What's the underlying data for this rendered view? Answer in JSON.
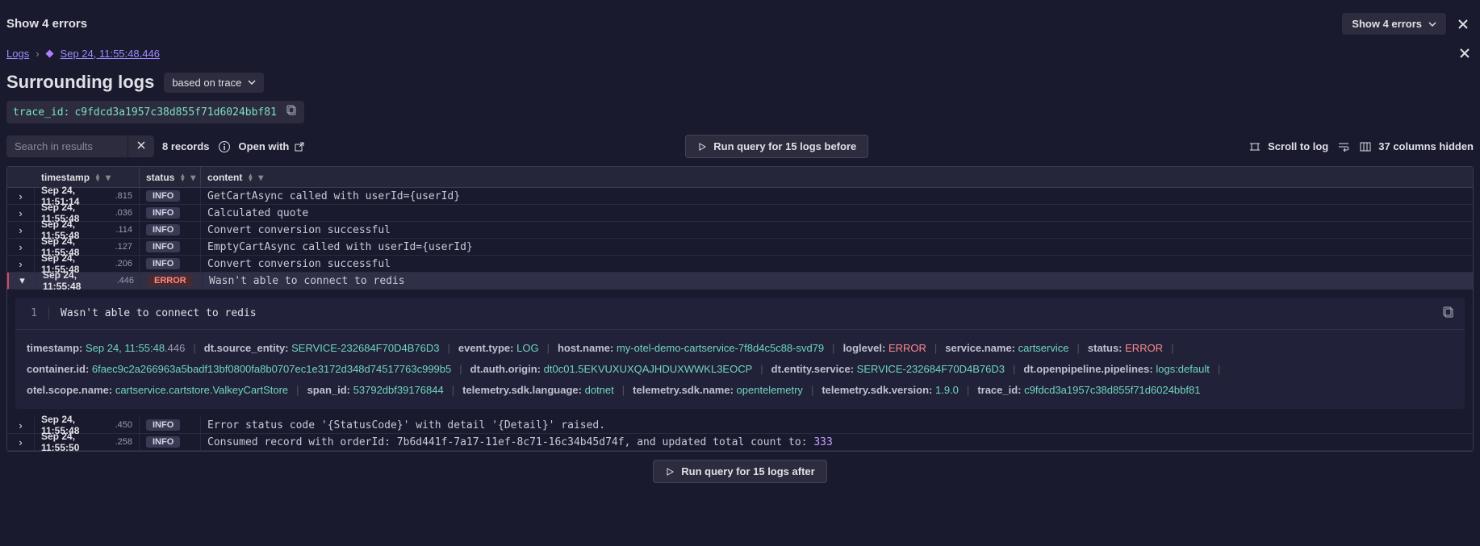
{
  "header": {
    "title": "Show 4 errors",
    "show_errors_btn": "Show 4 errors"
  },
  "breadcrumb": {
    "root": "Logs",
    "current": "Sep 24, 11:55:48",
    "current_ms": ".446"
  },
  "surrounding": {
    "title": "Surrounding logs",
    "mode": "based on trace"
  },
  "trace": {
    "key": "trace_id:",
    "value": "c9fdcd3a1957c38d855f71d6024bbf81"
  },
  "toolbar": {
    "search_placeholder": "Search in results",
    "records": "8 records",
    "open_with": "Open with",
    "run_before": "Run query for 15 logs before",
    "scroll": "Scroll to log",
    "columns_hidden": "37 columns hidden"
  },
  "columns": {
    "timestamp": "timestamp",
    "status": "status",
    "content": "content"
  },
  "rows": [
    {
      "ts": "Sep 24, 11:51:14",
      "ms": ".815",
      "status": "INFO",
      "content": "GetCartAsync called with userId={userId}"
    },
    {
      "ts": "Sep 24, 11:55:48",
      "ms": ".036",
      "status": "INFO",
      "content": "Calculated quote"
    },
    {
      "ts": "Sep 24, 11:55:48",
      "ms": ".114",
      "status": "INFO",
      "content": "Convert conversion successful"
    },
    {
      "ts": "Sep 24, 11:55:48",
      "ms": ".127",
      "status": "INFO",
      "content": "EmptyCartAsync called with userId={userId}"
    },
    {
      "ts": "Sep 24, 11:55:48",
      "ms": ".206",
      "status": "INFO",
      "content": "Convert conversion successful"
    },
    {
      "ts": "Sep 24, 11:55:48",
      "ms": ".446",
      "status": "ERROR",
      "content": "Wasn't able to connect to redis",
      "expanded": true
    },
    {
      "ts": "Sep 24, 11:55:48",
      "ms": ".450",
      "status": "INFO",
      "content": "Error status code '{StatusCode}' with detail '{Detail}' raised."
    },
    {
      "ts": "Sep 24, 11:55:50",
      "ms": ".258",
      "status": "INFO",
      "content_pre": "Consumed record with orderId: 7b6d441f-7a17-11ef-8c71-16c34b45d74f, and updated total count to: ",
      "content_num": "333"
    }
  ],
  "detail": {
    "line": "1",
    "text": "Wasn't able to connect to redis",
    "kv": [
      {
        "k": "timestamp:",
        "v": "Sep 24, 11:55:48",
        "ms": ".446"
      },
      {
        "k": "dt.source_entity:",
        "v": "SERVICE-232684F70D4B76D3"
      },
      {
        "k": "event.type:",
        "v": "LOG"
      },
      {
        "k": "host.name:",
        "v": "my-otel-demo-cartservice-7f8d4c5c88-svd79"
      },
      {
        "k": "loglevel:",
        "v": "ERROR",
        "err": true
      },
      {
        "k": "service.name:",
        "v": "cartservice"
      },
      {
        "k": "status:",
        "v": "ERROR",
        "err": true
      },
      {
        "k": "container.id:",
        "v": "6faec9c2a266963a5badf13bf0800fa8b0707ec1e3172d348d74517763c999b5"
      },
      {
        "k": "dt.auth.origin:",
        "v": "dt0c01.5EKVUXUXQAJHDUXWWKL3EOCP"
      },
      {
        "k": "dt.entity.service:",
        "v": "SERVICE-232684F70D4B76D3"
      },
      {
        "k": "dt.openpipeline.pipelines:",
        "v": "logs:default"
      },
      {
        "k": "otel.scope.name:",
        "v": "cartservice.cartstore.ValkeyCartStore"
      },
      {
        "k": "span_id:",
        "v": "53792dbf39176844"
      },
      {
        "k": "telemetry.sdk.language:",
        "v": "dotnet"
      },
      {
        "k": "telemetry.sdk.name:",
        "v": "opentelemetry"
      },
      {
        "k": "telemetry.sdk.version:",
        "v": "1.9.0"
      },
      {
        "k": "trace_id:",
        "v": "c9fdcd3a1957c38d855f71d6024bbf81"
      }
    ]
  },
  "footer": {
    "run_after": "Run query for 15 logs after"
  }
}
